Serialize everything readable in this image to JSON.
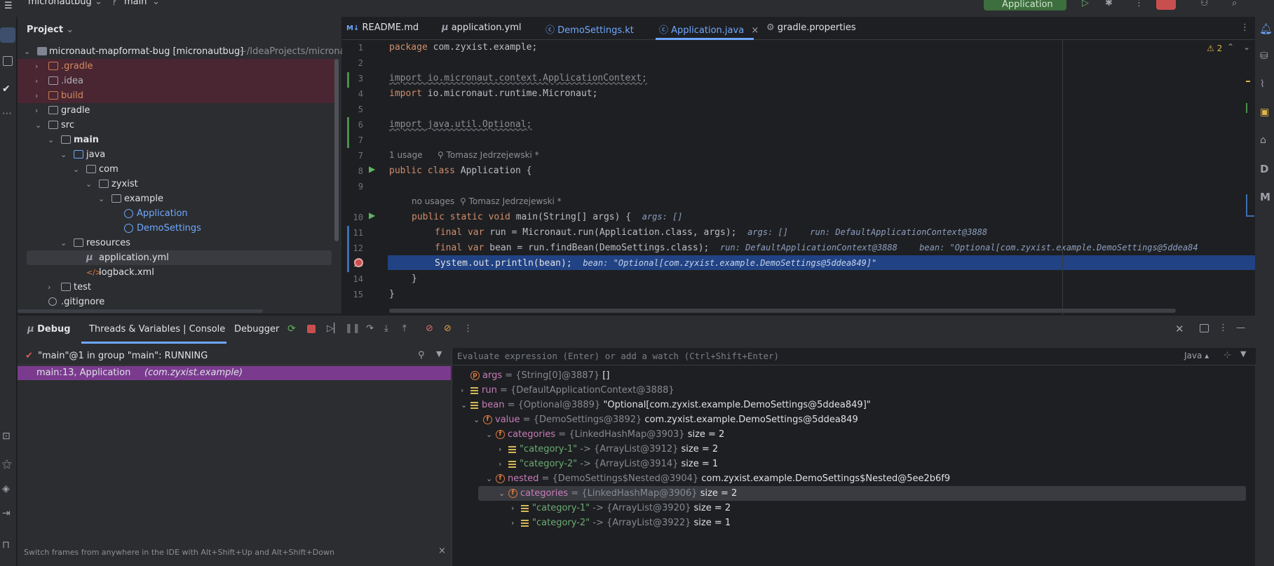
{
  "titlebar": {
    "project_name": "micronautbug",
    "branch": "main",
    "run_config": "Application"
  },
  "project_panel": {
    "title": "Project",
    "root_label": "micronaut-mapformat-bug [micronautbug]",
    "root_path": "~/IdeaProjects/microna",
    "items": [
      {
        "label": ".gradle"
      },
      {
        "label": ".idea"
      },
      {
        "label": "build"
      },
      {
        "label": "gradle"
      },
      {
        "label": "src"
      },
      {
        "label": "main"
      },
      {
        "label": "java"
      },
      {
        "label": "com"
      },
      {
        "label": "zyxist"
      },
      {
        "label": "example"
      },
      {
        "label": "Application"
      },
      {
        "label": "DemoSettings"
      },
      {
        "label": "resources"
      },
      {
        "label": "application.yml"
      },
      {
        "label": "logback.xml"
      },
      {
        "label": "test"
      },
      {
        "label": ".gitignore"
      }
    ]
  },
  "editor": {
    "tabs": [
      {
        "label": "README.md"
      },
      {
        "label": "application.yml"
      },
      {
        "label": "DemoSettings.kt"
      },
      {
        "label": "Application.java"
      },
      {
        "label": "gradle.properties"
      }
    ],
    "warnings_count": "2",
    "line_numbers": [
      "1",
      "2",
      "3",
      "4",
      "5",
      "6",
      "7",
      "8",
      "9",
      "10",
      "11",
      "12",
      "13",
      "14",
      "15"
    ],
    "lines": {
      "l1_kw": "package",
      "l1_rest": " com.zyxist.example;",
      "l3": "import io.micronaut.context.ApplicationContext;",
      "l4_kw": "import",
      "l4_rest": " io.micronaut.runtime.Micronaut;",
      "l6": "import java.util.Optional;",
      "usage1": "1 usage",
      "author1": "Tomasz Jedrzejewski *",
      "l8_kw": "public class",
      "l8_rest": " Application {",
      "usage2": "no usages",
      "author2": "Tomasz Jedrzejewski *",
      "l10_kw": "public static void",
      "l10_rest": " main(String[] args) {",
      "l10_hint": "args: []",
      "l11_kw": "final var",
      "l11_rest": " run = Micronaut.run(Application.class, args);",
      "l11_hint1": "args: []",
      "l11_hint2": "run: DefaultApplicationContext@3888",
      "l12_kw": "final var",
      "l12_rest": " bean = run.findBean(DemoSettings.class);",
      "l12_hint1": "run: DefaultApplicationContext@3888",
      "l12_hint2": "bean: \"Optional[com.zyxist.example.DemoSettings@5ddea84",
      "l13": "System.out.println(bean);",
      "l13_hint": "bean: \"Optional[com.zyxist.example.DemoSettings@5ddea849]\"",
      "l14": "}",
      "l15": "}"
    }
  },
  "debug_panel": {
    "title": "Debug",
    "tabs": [
      {
        "label": "Threads & Variables | Console"
      },
      {
        "label": "Debugger"
      }
    ],
    "thread_status": "\"main\"@1 in group \"main\": RUNNING",
    "frame": "main:13, Application",
    "frame_pkg": "(com.zyxist.example)",
    "hint_text": "Switch frames from anywhere in the IDE with Alt+Shift+Up and Alt+Shift+Down",
    "expression_placeholder": "Evaluate expression (Enter) or add a watch (Ctrl+Shift+Enter)",
    "language": "Java",
    "variables": [
      {
        "name": "args",
        "type": "= {String[0]@3887}",
        "value": "[]"
      },
      {
        "name": "run",
        "type": "= {DefaultApplicationContext@3888}",
        "value": ""
      },
      {
        "name": "bean",
        "type": "= {Optional@3889}",
        "value": "\"Optional[com.zyxist.example.DemoSettings@5ddea849]\""
      },
      {
        "name": "value",
        "type": "= {DemoSettings@3892}",
        "value": "com.zyxist.example.DemoSettings@5ddea849"
      },
      {
        "name": "categories",
        "type": "= {LinkedHashMap@3903}",
        "value": "size = 2"
      },
      {
        "name": "\"category-1\"",
        "type": "-> {ArrayList@3912}",
        "value": "size = 2"
      },
      {
        "name": "\"category-2\"",
        "type": "-> {ArrayList@3914}",
        "value": "size = 1"
      },
      {
        "name": "nested",
        "type": "= {DemoSettings$Nested@3904}",
        "value": "com.zyxist.example.DemoSettings$Nested@5ee2b6f9"
      },
      {
        "name": "categories",
        "type": "= {LinkedHashMap@3906}",
        "value": "size = 2"
      },
      {
        "name": "\"category-1\"",
        "type": "-> {ArrayList@3920}",
        "value": "size = 2"
      },
      {
        "name": "\"category-2\"",
        "type": "-> {ArrayList@3922}",
        "value": "size = 1"
      }
    ]
  },
  "colors": {
    "accent": "#6fa8ff",
    "selection": "#214283",
    "frame_selected": "#7a3b8f",
    "excluded_folder": "#4a2633",
    "run_green": "#3d6e3d"
  }
}
